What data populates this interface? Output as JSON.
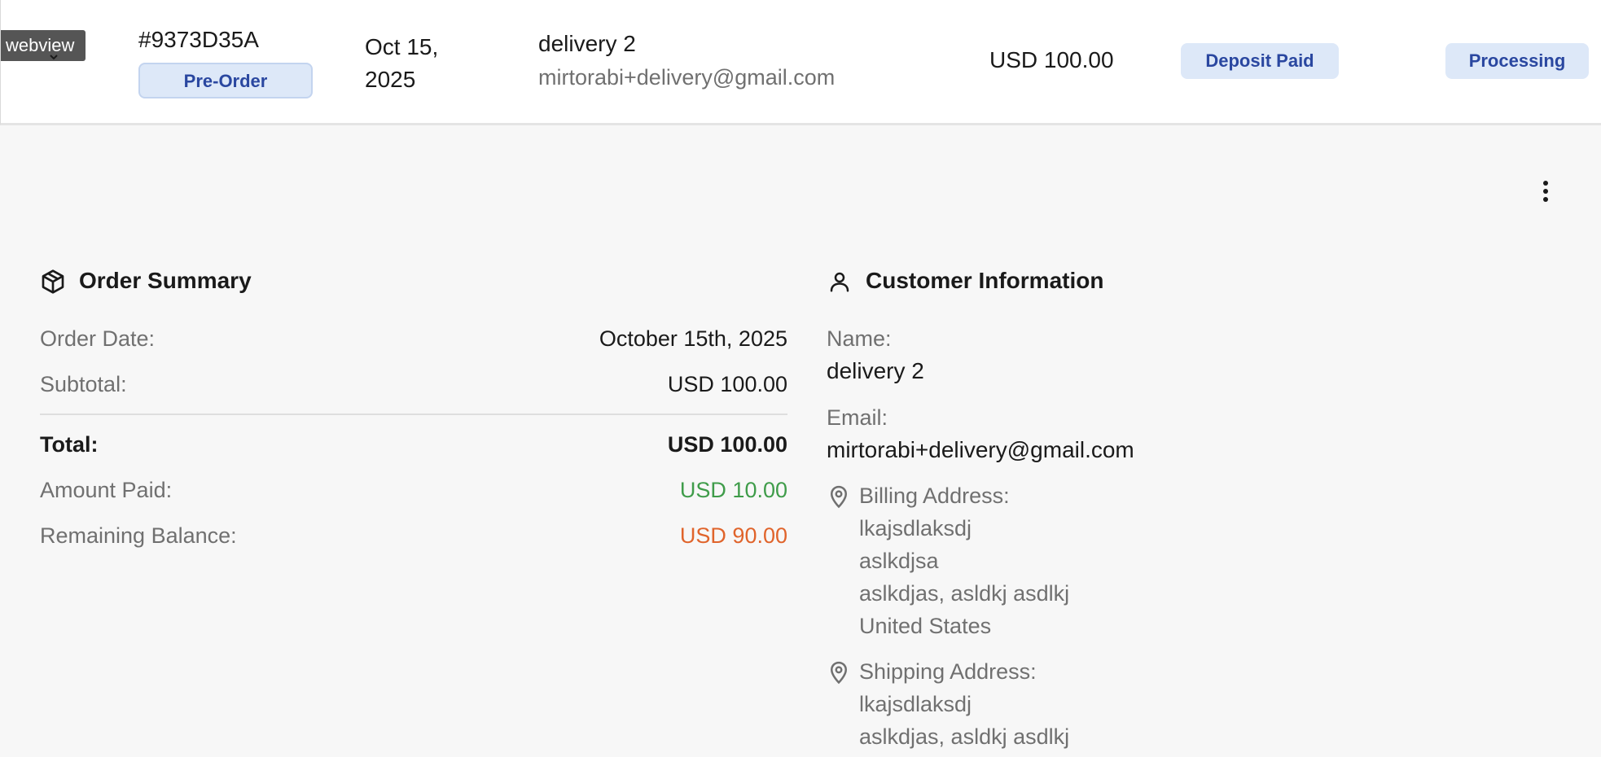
{
  "tooltip": {
    "label": "webview"
  },
  "order_row": {
    "id": "#9373D35A",
    "type_badge": "Pre-Order",
    "date_line1": "Oct 15,",
    "date_line2": "2025",
    "customer_name": "delivery 2",
    "customer_email": "mirtorabi+delivery@gmail.com",
    "amount": "USD 100.00",
    "payment_badge": "Deposit Paid",
    "status_badge": "Processing",
    "colors": {
      "badge_bg": "#dde8f8",
      "badge_text": "#2a47a0"
    }
  },
  "order_summary": {
    "title": "Order Summary",
    "icon": "package-icon",
    "rows": [
      {
        "label": "Order Date:",
        "value": "October 15th, 2025"
      },
      {
        "label": "Subtotal:",
        "value": "USD 100.00"
      },
      {
        "label": "Total:",
        "value": "USD 100.00"
      },
      {
        "label": "Amount Paid:",
        "value": "USD 10.00"
      },
      {
        "label": "Remaining Balance:",
        "value": "USD 90.00"
      }
    ],
    "colors": {
      "paid": "#3f9c4a",
      "remaining": "#e0642b"
    }
  },
  "customer_info": {
    "title": "Customer Information",
    "icon": "user-icon",
    "name_label": "Name:",
    "name_value": "delivery 2",
    "email_label": "Email:",
    "email_value": "mirtorabi+delivery@gmail.com",
    "billing": {
      "label": "Billing Address:",
      "icon": "location-pin-icon",
      "lines": [
        "lkajsdlaksdj",
        "aslkdjsa",
        "aslkdjas, asldkj asdlkj",
        "United States"
      ]
    },
    "shipping": {
      "label": "Shipping Address:",
      "icon": "location-pin-icon",
      "lines": [
        "lkajsdlaksdj",
        "aslkdjas, asldkj asdlkj"
      ]
    }
  },
  "menu": {
    "icon": "more-vertical-icon"
  }
}
